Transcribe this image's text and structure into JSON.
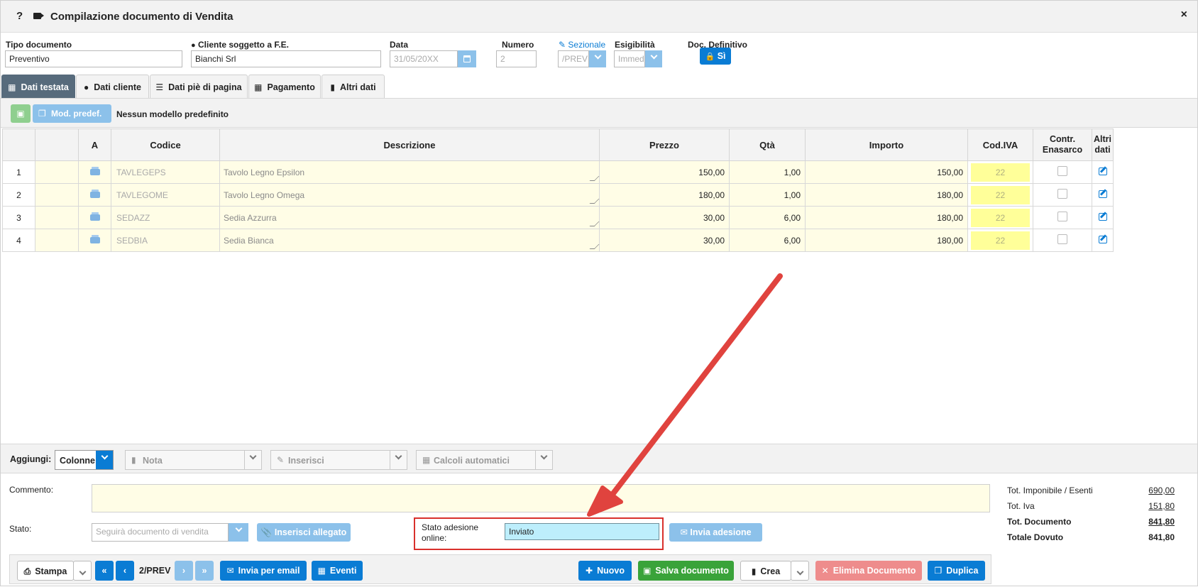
{
  "window": {
    "help": "?",
    "title": "Compilazione documento di Vendita",
    "close": "×"
  },
  "header": {
    "tipo_label": "Tipo documento",
    "tipo_value": "Preventivo",
    "cliente_label": "Cliente soggetto a F.E.",
    "cliente_value": "Bianchi Srl",
    "data_label": "Data",
    "data_value": "31/05/20XX",
    "numero_label": "Numero",
    "numero_value": "2",
    "sezionale_label": "Sezionale",
    "sezionale_value": "/PREV",
    "esigibilita_label": "Esigibilità",
    "esigibilita_value": "Immed",
    "definitivo_label": "Doc. Definitivo",
    "definitivo_value": "Sì"
  },
  "tabs": [
    {
      "label": "Dati testata",
      "active": true
    },
    {
      "label": "Dati cliente"
    },
    {
      "label": "Dati piè di pagina"
    },
    {
      "label": "Pagamento"
    },
    {
      "label": "Altri dati"
    }
  ],
  "toolbar": {
    "mod_label": "Mod. predef.",
    "model_text": "Nessun modello predefinito"
  },
  "table": {
    "headers": [
      "",
      "",
      "A",
      "Codice",
      "Descrizione",
      "Prezzo",
      "Qtà",
      "Importo",
      "Cod.IVA",
      "Contr. Enasarco",
      "Altri dati"
    ],
    "rows": [
      {
        "n": "1",
        "codice": "TAVLEGEPS",
        "descrizione": "Tavolo Legno Epsilon",
        "prezzo": "150,00",
        "qta": "1,00",
        "importo": "150,00",
        "iva": "22"
      },
      {
        "n": "2",
        "codice": "TAVLEGOME",
        "descrizione": "Tavolo Legno Omega",
        "prezzo": "180,00",
        "qta": "1,00",
        "importo": "180,00",
        "iva": "22"
      },
      {
        "n": "3",
        "codice": "SEDAZZ",
        "descrizione": "Sedia Azzurra",
        "prezzo": "30,00",
        "qta": "6,00",
        "importo": "180,00",
        "iva": "22"
      },
      {
        "n": "4",
        "codice": "SEDBIA",
        "descrizione": "Sedia Bianca",
        "prezzo": "30,00",
        "qta": "6,00",
        "importo": "180,00",
        "iva": "22"
      }
    ]
  },
  "addbar": {
    "label": "Aggiungi:",
    "colonne": "Colonne",
    "nota": "Nota",
    "inserisci": "Inserisci",
    "calcoli": "Calcoli automatici"
  },
  "footer": {
    "commento_label": "Commento:",
    "stato_label": "Stato:",
    "stato_placeholder": "Seguirà documento di vendita",
    "allegato_button": "Inserisci allegato",
    "adesione_label": "Stato adesione online:",
    "adesione_value": "Inviato",
    "invia_adesione": "Invia adesione"
  },
  "totals": {
    "imponibile_label": "Tot. Imponibile / Esenti",
    "imponibile_value": "690,00",
    "iva_label": "Tot. Iva",
    "iva_value": "151,80",
    "documento_label": "Tot. Documento",
    "documento_value": "841,80",
    "dovuto_label": "Totale Dovuto",
    "dovuto_value": "841,80"
  },
  "bottombar": {
    "stampa": "Stampa",
    "record": "2/PREV",
    "email": "Invia per email",
    "eventi": "Eventi",
    "nuovo": "Nuovo",
    "salva": "Salva documento",
    "crea": "Crea",
    "elimina": "Elimina Documento",
    "duplica": "Duplica"
  },
  "colors": {
    "accent": "#0a7cd4",
    "tab_active": "#576b7c",
    "highlight_input": "#bdeefc",
    "annotation": "#d9302c"
  }
}
